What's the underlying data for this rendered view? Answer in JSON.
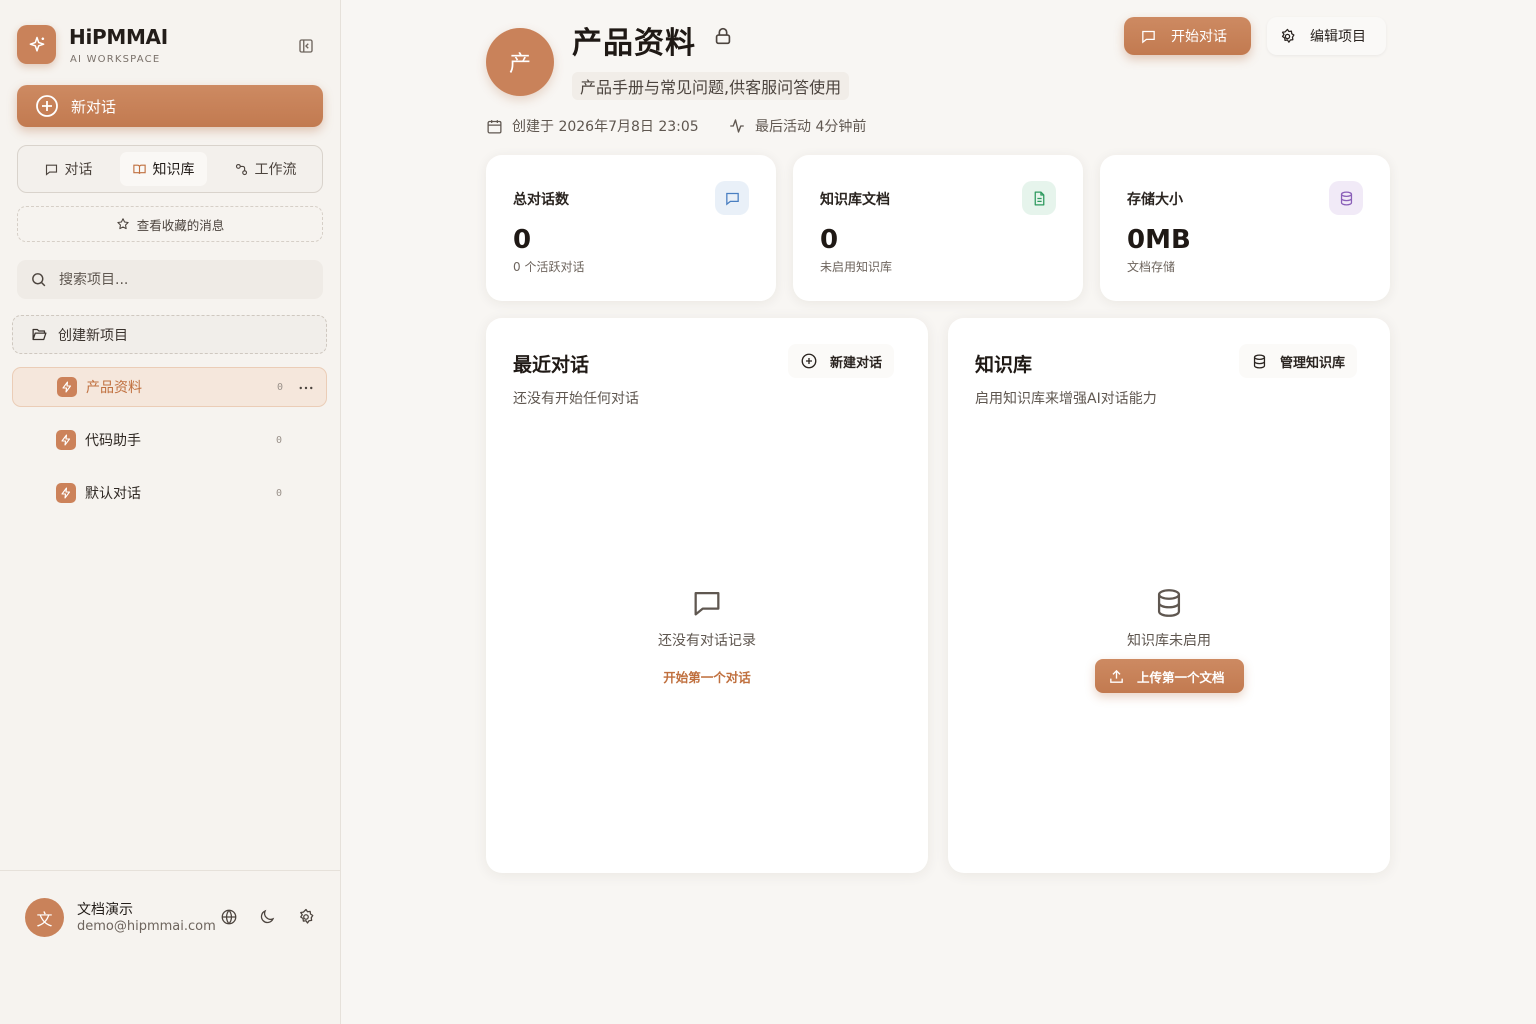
{
  "brand": {
    "name": "HiPMMAI",
    "subtitle": "AI WORKSPACE"
  },
  "sidebar": {
    "new_chat_label": "新对话",
    "tabs": [
      {
        "label": "对话",
        "icon": "message-icon"
      },
      {
        "label": "知识库",
        "icon": "book-icon",
        "active": true
      },
      {
        "label": "工作流",
        "icon": "workflow-icon"
      }
    ],
    "favorites_label": "查看收藏的消息",
    "search_placeholder": "搜索项目...",
    "create_project_label": "创建新项目",
    "projects": [
      {
        "name": "产品资料",
        "count": "0",
        "active": true
      },
      {
        "name": "代码助手",
        "count": "0"
      },
      {
        "name": "默认对话",
        "count": "0"
      }
    ]
  },
  "user": {
    "avatar_letter": "文",
    "name": "文档演示",
    "email": "demo@hipmmai.com"
  },
  "header": {
    "avatar_letter": "产",
    "title": "产品资料",
    "description": "产品手册与常见问题,供客服问答使用",
    "created": "创建于 2026年7月8日 23:05",
    "last_active": "最后活动 4分钟前",
    "start_chat_label": "开始对话",
    "edit_project_label": "编辑项目"
  },
  "stats": [
    {
      "label": "总对话数",
      "value": "0",
      "sub": "0 个活跃对话",
      "icon": "chat-icon",
      "color": "#4a7fc1"
    },
    {
      "label": "知识库文档",
      "value": "0",
      "sub": "未启用知识库",
      "icon": "document-icon",
      "color": "#2e9a5f"
    },
    {
      "label": "存储大小",
      "value": "0MB",
      "sub": "文档存储",
      "icon": "database-icon",
      "color": "#8a5fb8"
    }
  ],
  "recent": {
    "title": "最近对话",
    "subtitle": "还没有开始任何对话",
    "button_label": "新建对话",
    "empty_text": "还没有对话记录",
    "empty_link": "开始第一个对话"
  },
  "kb": {
    "title": "知识库",
    "subtitle": "启用知识库来增强AI对话能力",
    "button_label": "管理知识库",
    "empty_text": "知识库未启用",
    "upload_label": "上传第一个文档"
  },
  "colors": {
    "accent": "#c9825a",
    "accent_dark": "#c0703f",
    "background": "#f8f6f3"
  }
}
